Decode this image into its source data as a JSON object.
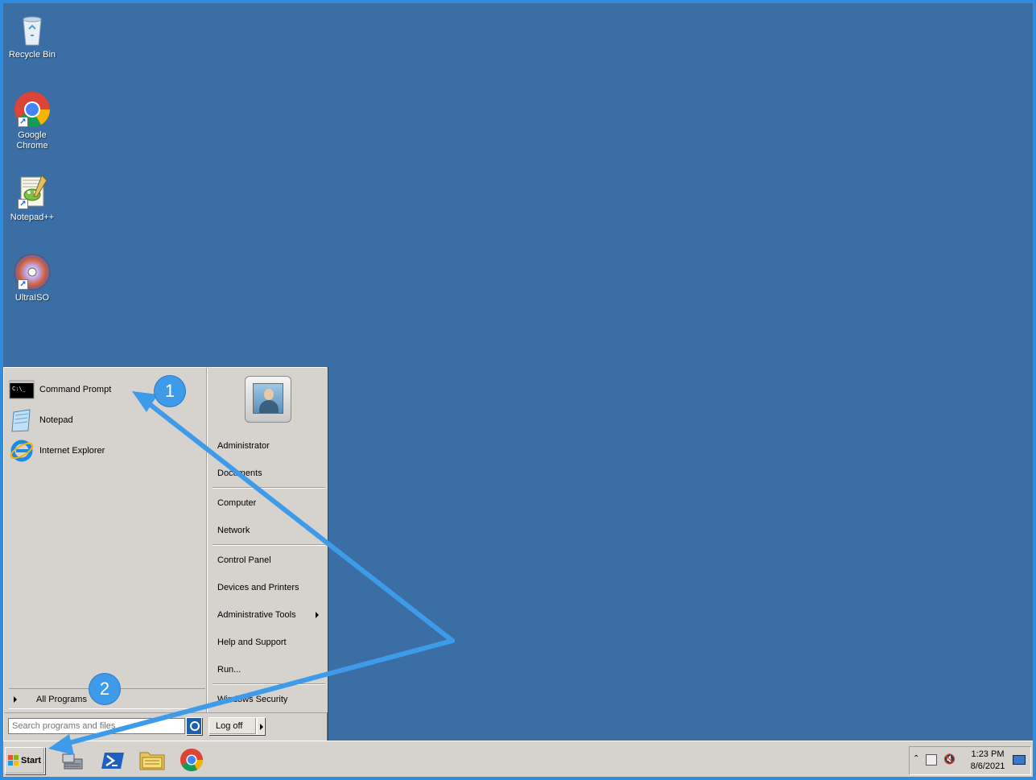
{
  "desktop": {
    "icons": [
      {
        "label": "Recycle Bin",
        "icon": "recycle-bin-icon"
      },
      {
        "label": "Google Chrome",
        "icon": "chrome-icon"
      },
      {
        "label": "Notepad++",
        "icon": "notepadpp-icon"
      },
      {
        "label": "UltraISO",
        "icon": "ultraiso-icon"
      }
    ]
  },
  "start_menu": {
    "pinned": [
      {
        "label": "Command Prompt",
        "icon": "cmd-icon"
      },
      {
        "label": "Notepad",
        "icon": "notepad-icon"
      },
      {
        "label": "Internet Explorer",
        "icon": "ie-icon"
      }
    ],
    "all_programs": "All Programs",
    "search_placeholder": "Search programs and files",
    "right": {
      "user": "Administrator",
      "documents": "Documents",
      "computer": "Computer",
      "network": "Network",
      "control_panel": "Control Panel",
      "devices_printers": "Devices and Printers",
      "admin_tools": "Administrative Tools",
      "help_support": "Help and Support",
      "run": "Run...",
      "windows_security": "Windows Security"
    },
    "log_off": "Log off"
  },
  "taskbar": {
    "start_label": "Start",
    "time": "1:23 PM",
    "date": "8/6/2021",
    "apps": [
      "server-manager-icon",
      "powershell-icon",
      "file-explorer-icon",
      "chrome-icon"
    ]
  },
  "annotations": {
    "step1": "1",
    "step2": "2",
    "arrow_color": "#3d9bea"
  }
}
